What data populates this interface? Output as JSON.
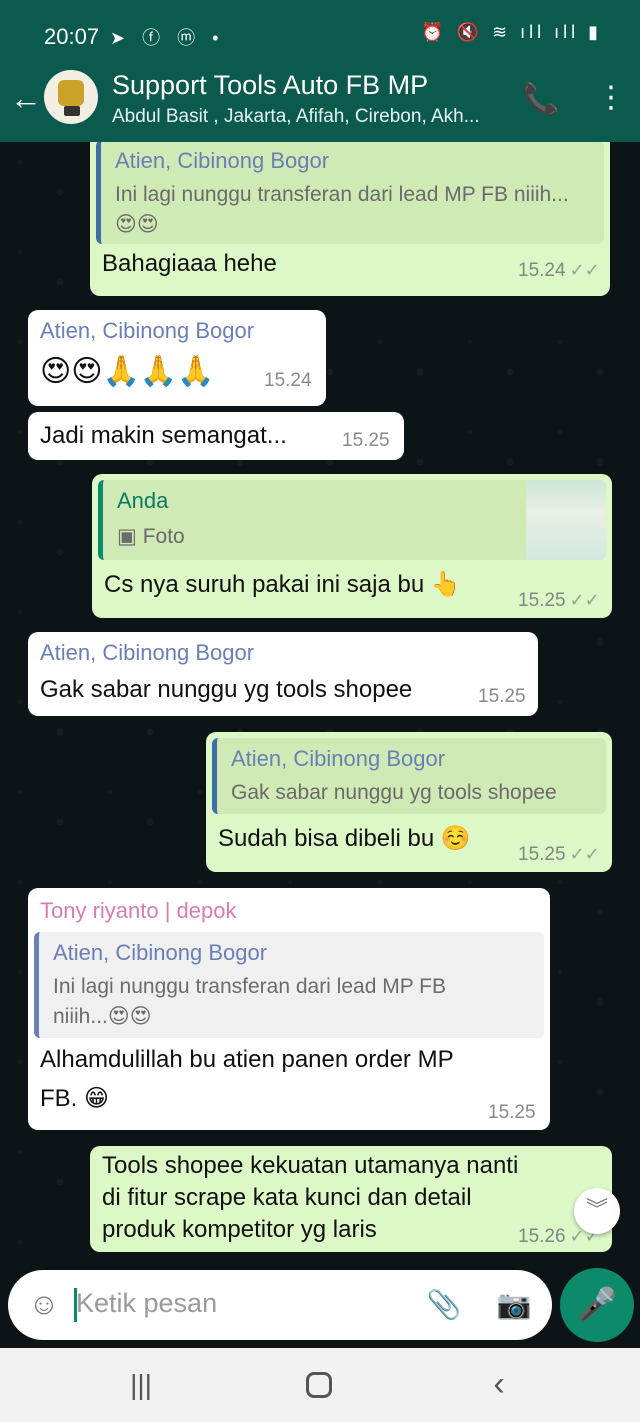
{
  "status": {
    "time": "20:07",
    "left_icons": "➤ ⓕ ⓜ •",
    "right_icons": "⏰ 🔇 ≋ ıll ıll ▮"
  },
  "header": {
    "title": "Support Tools Auto FB MP",
    "subtitle": "Abdul Basit , Jakarta, Afifah, Cirebon, Akh..."
  },
  "messages": [
    {
      "quote_name": "Atien, Cibinong Bogor",
      "quote_text": "Ini lagi nunggu transferan dari lead MP FB niiih...😍😍",
      "text": "Bahagiaaa hehe",
      "time": "15.24",
      "ticks": "✓✓"
    },
    {
      "sender": "Atien, Cibinong Bogor",
      "text": "😍😍🙏🙏🙏",
      "time": "15.24"
    },
    {
      "text": "Jadi makin semangat...",
      "time": "15.25"
    },
    {
      "quote_name": "Anda",
      "quote_text": "Foto",
      "text": "Cs nya suruh pakai ini saja bu 👆",
      "time": "15.25",
      "ticks": "✓✓"
    },
    {
      "sender": "Atien, Cibinong Bogor",
      "text": "Gak sabar nunggu yg tools shopee",
      "time": "15.25"
    },
    {
      "quote_name": "Atien, Cibinong Bogor",
      "quote_text": "Gak sabar nunggu yg tools shopee",
      "text": "Sudah bisa dibeli bu ☺️",
      "time": "15.25",
      "ticks": "✓✓"
    },
    {
      "sender": "Tony riyanto | depok",
      "quote_name": "Atien, Cibinong Bogor",
      "quote_text_line1": "Ini lagi nunggu transferan dari lead MP FB",
      "quote_text_line2": "niiih...😍😍",
      "text_line1": "Alhamdulillah bu atien panen order MP",
      "text_line2": "FB. 😁",
      "time": "15.25"
    },
    {
      "text_line1": "Tools shopee kekuatan utamanya nanti",
      "text_line2": "di fitur scrape kata kunci dan detail",
      "text_line3": "produk kompetitor yg laris",
      "time": "15.26",
      "ticks": "✓✓"
    }
  ],
  "input": {
    "placeholder": "Ketik pesan"
  },
  "colors": {
    "header": "#0a5a4e",
    "outgoing_bubble": "#dcf8c6",
    "incoming_bubble": "#ffffff",
    "accent": "#0d8a6a"
  }
}
